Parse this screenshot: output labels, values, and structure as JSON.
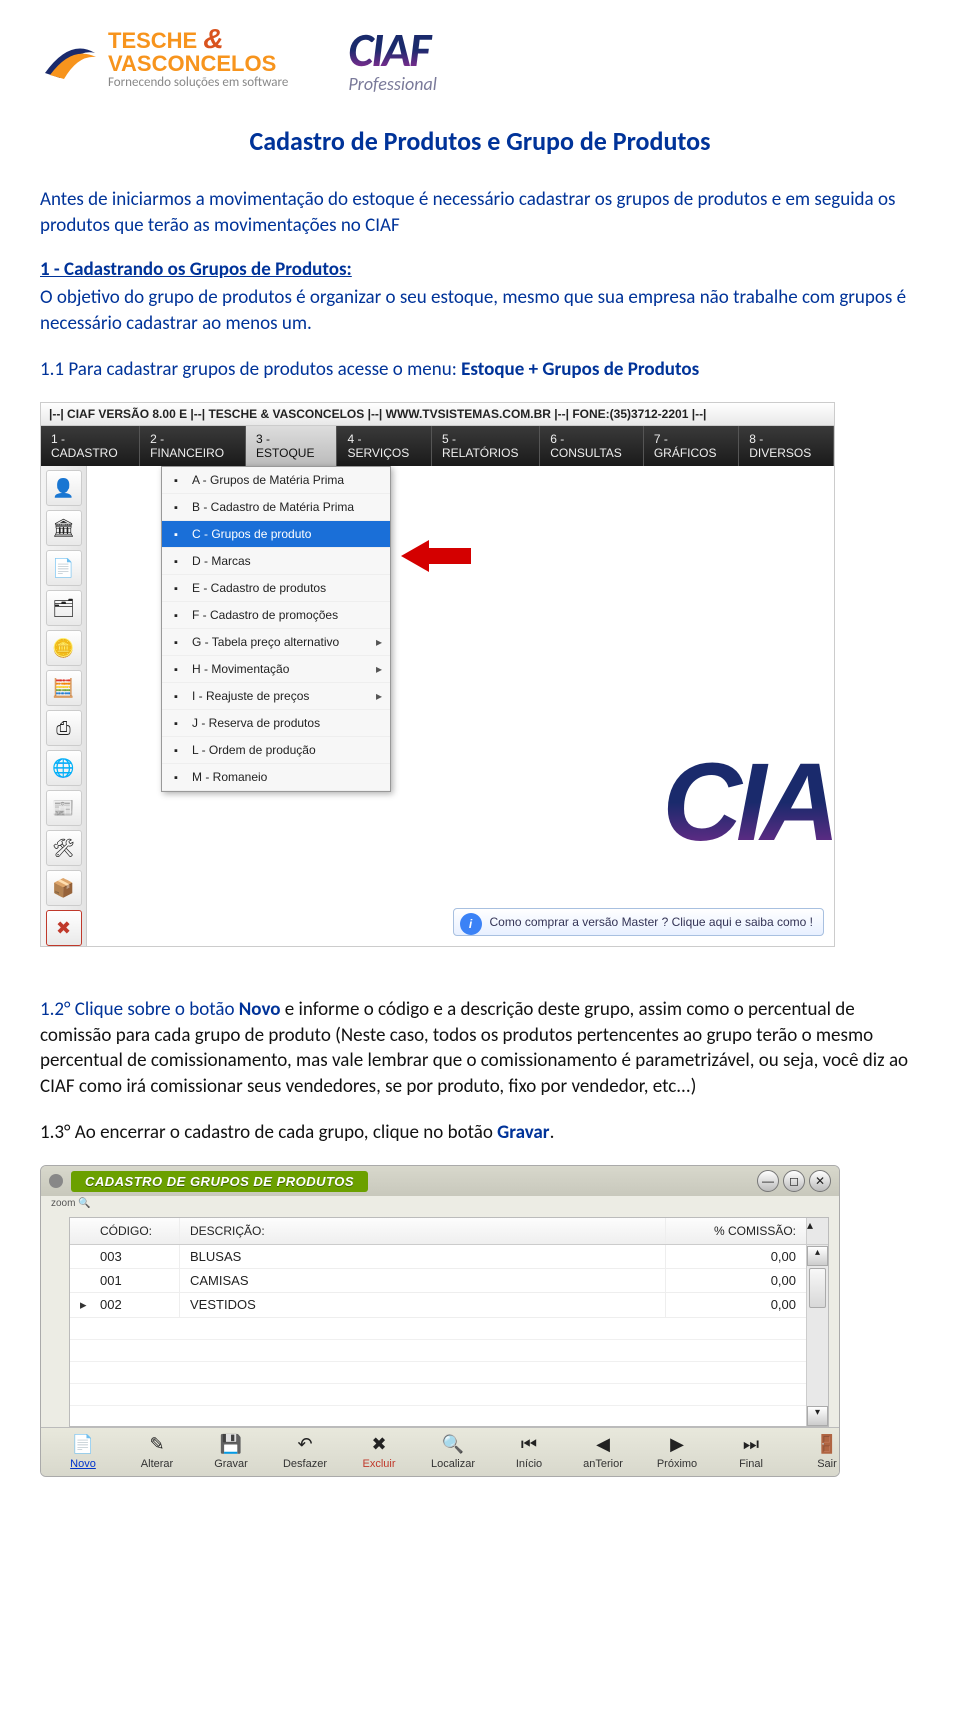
{
  "logos": {
    "tv_line1": "TESCHE",
    "tv_and": "&",
    "tv_line2": "VASCONCELOS",
    "tv_sub": "Fornecendo soluções em software",
    "ciaf": "CIAF",
    "ciaf_sub": "Professional"
  },
  "doc": {
    "title": "Cadastro de Produtos e Grupo de Produtos",
    "intro": "Antes de iniciarmos a movimentação do estoque é necessário cadastrar os grupos de produtos e em seguida os produtos que terão as movimentações no CIAF",
    "sec1_head": "1 - Cadastrando os Grupos de Produtos:",
    "sec1_body": "O objetivo do grupo de produtos é organizar o seu estoque, mesmo que sua empresa não trabalhe com grupos é necessário cadastrar ao menos um.",
    "sec1_1_pre": "1.1 Para cadastrar grupos de produtos  acesse o menu: ",
    "sec1_1_emph": "Estoque + Grupos de Produtos",
    "sec1_2_pre": "1.2° Clique sobre o botão ",
    "sec1_2_emph": "Novo",
    "sec1_2_rest": " e informe o código e a descrição deste grupo, assim como o percentual de comissão para cada grupo de produto (Neste caso, todos os produtos pertencentes ao grupo terão o mesmo percentual de comissionamento, mas vale lembrar que o comissionamento é parametrizável, ou seja, você diz ao CIAF como irá comissionar seus vendedores, se por produto, fixo por vendedor, etc...)",
    "sec1_3_pre": "1.3° Ao encerrar o cadastro de cada grupo, clique no botão ",
    "sec1_3_emph": "Gravar",
    "sec1_3_end": "."
  },
  "ss1": {
    "titlebar": "|--| CIAF VERSÃO 8.00 E |--| TESCHE & VASCONCELOS |--| WWW.TVSISTEMAS.COM.BR |--| FONE:(35)3712-2201 |--|",
    "menus": [
      "1 - CADASTRO",
      "2 - FINANCEIRO",
      "3 - ESTOQUE",
      "4 - SERVIÇOS",
      "5 - RELATÓRIOS",
      "6 - CONSULTAS",
      "7 - GRÁFICOS",
      "8 - DIVERSOS"
    ],
    "active_menu_index": 2,
    "dropdown": [
      {
        "label": "A - Grupos de Matéria Prima",
        "sub": false
      },
      {
        "label": "B - Cadastro de Matéria Prima",
        "sub": false
      },
      {
        "label": "C - Grupos de produto",
        "sub": false,
        "selected": true
      },
      {
        "label": "D - Marcas",
        "sub": false
      },
      {
        "label": "E - Cadastro de produtos",
        "sub": false
      },
      {
        "label": "F - Cadastro de promoções",
        "sub": false
      },
      {
        "label": "G - Tabela preço alternativo",
        "sub": true
      },
      {
        "label": "H - Movimentação",
        "sub": true
      },
      {
        "label": "I - Reajuste de preços",
        "sub": true
      },
      {
        "label": "J - Reserva de produtos",
        "sub": false
      },
      {
        "label": "L - Ordem de produção",
        "sub": false
      },
      {
        "label": "M - Romaneio",
        "sub": false
      }
    ],
    "sidebar_icons": [
      "👤",
      "🏛",
      "📄",
      "🗂",
      "🪙",
      "🧮",
      "⎙",
      "🌐",
      "📰",
      "🛠",
      "📦",
      "✖"
    ],
    "info_tip": "Como comprar a versão Master ? Clique aqui e saiba como !",
    "bg_brand": "CIA"
  },
  "ss2": {
    "window_title": "CADASTRO DE GRUPOS DE PRODUTOS",
    "zoom_label": "zoom 🔍",
    "columns": {
      "code": "CÓDIGO:",
      "desc": "DESCRIÇÃO:",
      "com": "% COMISSÃO:"
    },
    "rows": [
      {
        "code": "003",
        "desc": "BLUSAS",
        "com": "0,00",
        "ptr": ""
      },
      {
        "code": "001",
        "desc": "CAMISAS",
        "com": "0,00",
        "ptr": ""
      },
      {
        "code": "002",
        "desc": "VESTIDOS",
        "com": "0,00",
        "ptr": "▸"
      }
    ],
    "footer_buttons": [
      {
        "name": "novo-button",
        "label": "Novo",
        "icon": "📄"
      },
      {
        "name": "alterar-button",
        "label": "Alterar",
        "icon": "✎"
      },
      {
        "name": "gravar-button",
        "label": "Gravar",
        "icon": "💾"
      },
      {
        "name": "desfazer-button",
        "label": "Desfazer",
        "icon": "↶"
      },
      {
        "name": "excluir-button",
        "label": "Excluir",
        "icon": "✖"
      },
      {
        "name": "localizar-button",
        "label": "Localizar",
        "icon": "🔍"
      }
    ],
    "nav_buttons": [
      {
        "name": "inicio-button",
        "label": "Início",
        "icon": "⏮"
      },
      {
        "name": "anterior-button",
        "label": "anTerior",
        "icon": "◀"
      },
      {
        "name": "proximo-button",
        "label": "Próximo",
        "icon": "▶"
      },
      {
        "name": "final-button",
        "label": "Final",
        "icon": "⏭"
      }
    ],
    "sair": {
      "name": "sair-button",
      "label": "Sair",
      "icon": "🚪"
    }
  }
}
